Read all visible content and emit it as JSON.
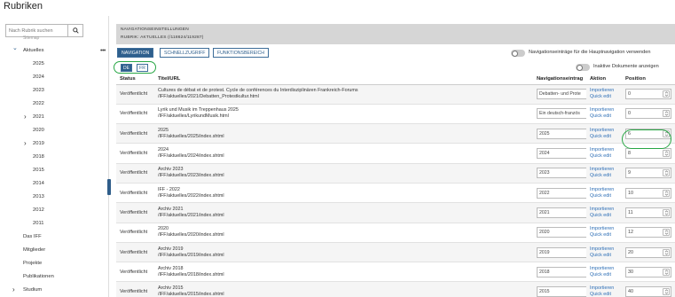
{
  "app": {
    "title": "Rubriken"
  },
  "sidebar": {
    "search_placeholder": "Nach Rubrik suchen",
    "cutoff_item": "Sitemap",
    "items": [
      {
        "label": "Aktuelles",
        "expand": "open"
      },
      {
        "label": "2025",
        "expand": "none"
      },
      {
        "label": "2024",
        "expand": "none"
      },
      {
        "label": "2023",
        "expand": "none"
      },
      {
        "label": "2022",
        "expand": "none"
      },
      {
        "label": "2021",
        "expand": "closed"
      },
      {
        "label": "2020",
        "expand": "none"
      },
      {
        "label": "2019",
        "expand": "closed"
      },
      {
        "label": "2018",
        "expand": "none"
      },
      {
        "label": "2015",
        "expand": "none"
      },
      {
        "label": "2014",
        "expand": "none"
      },
      {
        "label": "2013",
        "expand": "none"
      },
      {
        "label": "2012",
        "expand": "none"
      },
      {
        "label": "2011",
        "expand": "none"
      },
      {
        "label": "Das IFF",
        "expand": "none"
      },
      {
        "label": "Mitglieder",
        "expand": "none"
      },
      {
        "label": "Projekte",
        "expand": "none"
      },
      {
        "label": "Publikationen",
        "expand": "none"
      },
      {
        "label": "Studium",
        "expand": "closed"
      }
    ],
    "more_label": "•••"
  },
  "panel": {
    "heading": "NAVIGATIONSEINSTELLUNGEN",
    "subheading": "RUBRIK: AKTUELLES (/118624/119287)"
  },
  "tabs": [
    {
      "label": "NAVIGATION",
      "active": true
    },
    {
      "label": "SCHNELLZUGRIFF",
      "active": false
    },
    {
      "label": "FUNKTIONSBEREICH",
      "active": false
    }
  ],
  "toggles": {
    "main_nav": "Navigationseinträge für die Hauptnavigation verwenden",
    "inactive_docs": "Inaktive Dokumente anzeigen"
  },
  "languages": [
    {
      "label": "DE",
      "active": true
    },
    {
      "label": "FR",
      "active": false
    }
  ],
  "table": {
    "headers": {
      "status": "Status",
      "title": "Titel/URL",
      "nav": "Navigationseintrag",
      "action": "Aktion",
      "position": "Position"
    },
    "action_labels": {
      "import": "Importieren",
      "quick": "Quick edit"
    },
    "rows": [
      {
        "status": "Veröffentlicht",
        "title": "Cultures de débat et de protest. Cycle de conférences du Interdisziplinären Frankreich-Forums",
        "url": "/IFF/aktuelles/2021/Debatten_Protestkultur.html",
        "nav": "Debatten- und Prote",
        "position": "0"
      },
      {
        "status": "Veröffentlicht",
        "title": "Lyrik und Musik im Treppenhaus 2025",
        "url": "/IFF/aktuelles/LyrikundMusik.html",
        "nav": "Ein deutsch-französ",
        "position": "0"
      },
      {
        "status": "Veröffentlicht",
        "title": "2025",
        "url": "/IFF/aktuelles/2025/index.shtml",
        "nav": "2025",
        "position": "6"
      },
      {
        "status": "Veröffentlicht",
        "title": "2024",
        "url": "/IFF/aktuelles/2024/index.shtml",
        "nav": "2024",
        "position": "8"
      },
      {
        "status": "Veröffentlicht",
        "title": "Archiv 2023",
        "url": "/IFF/aktuelles/2023/index.shtml",
        "nav": "2023",
        "position": "9"
      },
      {
        "status": "Veröffentlicht",
        "title": "IFF - 2022",
        "url": "/IFF/aktuelles/2022/index.shtml",
        "nav": "2022",
        "position": "10"
      },
      {
        "status": "Veröffentlicht",
        "title": "Archiv 2021",
        "url": "/IFF/aktuelles/2021/index.shtml",
        "nav": "2021",
        "position": "11"
      },
      {
        "status": "Veröffentlicht",
        "title": "2020",
        "url": "/IFF/aktuelles/2020/index.shtml",
        "nav": "2020",
        "position": "12"
      },
      {
        "status": "Veröffentlicht",
        "title": "Archiv 2019",
        "url": "/IFF/aktuelles/2019/index.shtml",
        "nav": "2019",
        "position": "20"
      },
      {
        "status": "Veröffentlicht",
        "title": "Archiv 2018",
        "url": "/IFF/aktuelles/2018/index.shtml",
        "nav": "2018",
        "position": "30"
      },
      {
        "status": "Veröffentlicht",
        "title": "Archiv 2015",
        "url": "/IFF/aktuelles/2015/index.shtml",
        "nav": "2015",
        "position": "40"
      }
    ]
  },
  "colors": {
    "accent": "#2e5f8d",
    "link": "#2e6fb6",
    "annotation": "#28a745",
    "header_bg": "#d6d6d6"
  }
}
